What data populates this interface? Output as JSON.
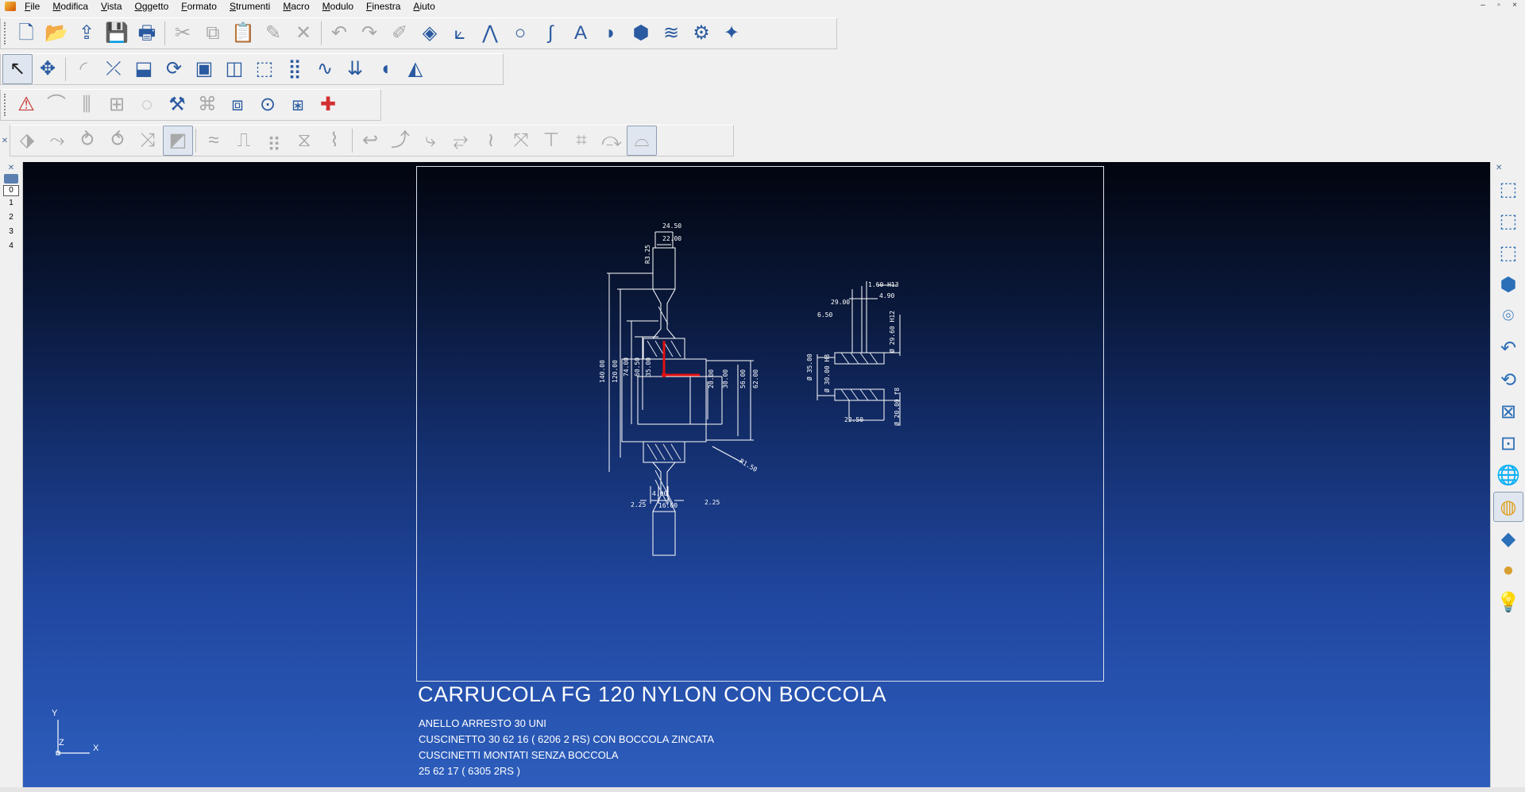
{
  "menu": [
    "File",
    "Modifica",
    "Vista",
    "Oggetto",
    "Formato",
    "Strumenti",
    "Macro",
    "Modulo",
    "Finestra",
    "Aiuto"
  ],
  "window_controls": [
    "–",
    "▫",
    "×"
  ],
  "layers": [
    "0",
    "1",
    "2",
    "3",
    "4"
  ],
  "drawing": {
    "title": "CARRUCOLA FG 120  NYLON CON BOCCOLA",
    "notes": [
      "ANELLO ARRESTO 30 UNI",
      "CUSCINETTO 30 62 16 ( 6206 2 RS)  CON BOCCOLA  ZINCATA",
      "CUSCINETTI MONTATI SENZA BOCCOLA",
      "25 62 17 ( 6305 2RS )"
    ],
    "dimensions_main": [
      "24.50",
      "22.00",
      "R3.25",
      "140.00",
      "120.00",
      "74.00",
      "60.50",
      "35.00",
      "20.00",
      "30.00",
      "56.00",
      "62.00",
      "R1.50",
      "4.00",
      "16.00",
      "2.25",
      "2.25"
    ],
    "dimensions_bush": [
      "1.60 H13",
      "4.90",
      "29.00",
      "6.50",
      "Ø 29.60 H12",
      "Ø 35.00",
      "Ø 30.00 H8",
      "Ø 20.00 f8",
      "22.50"
    ],
    "axis_labels": {
      "x": "X",
      "y": "Y",
      "z": "Z"
    }
  }
}
